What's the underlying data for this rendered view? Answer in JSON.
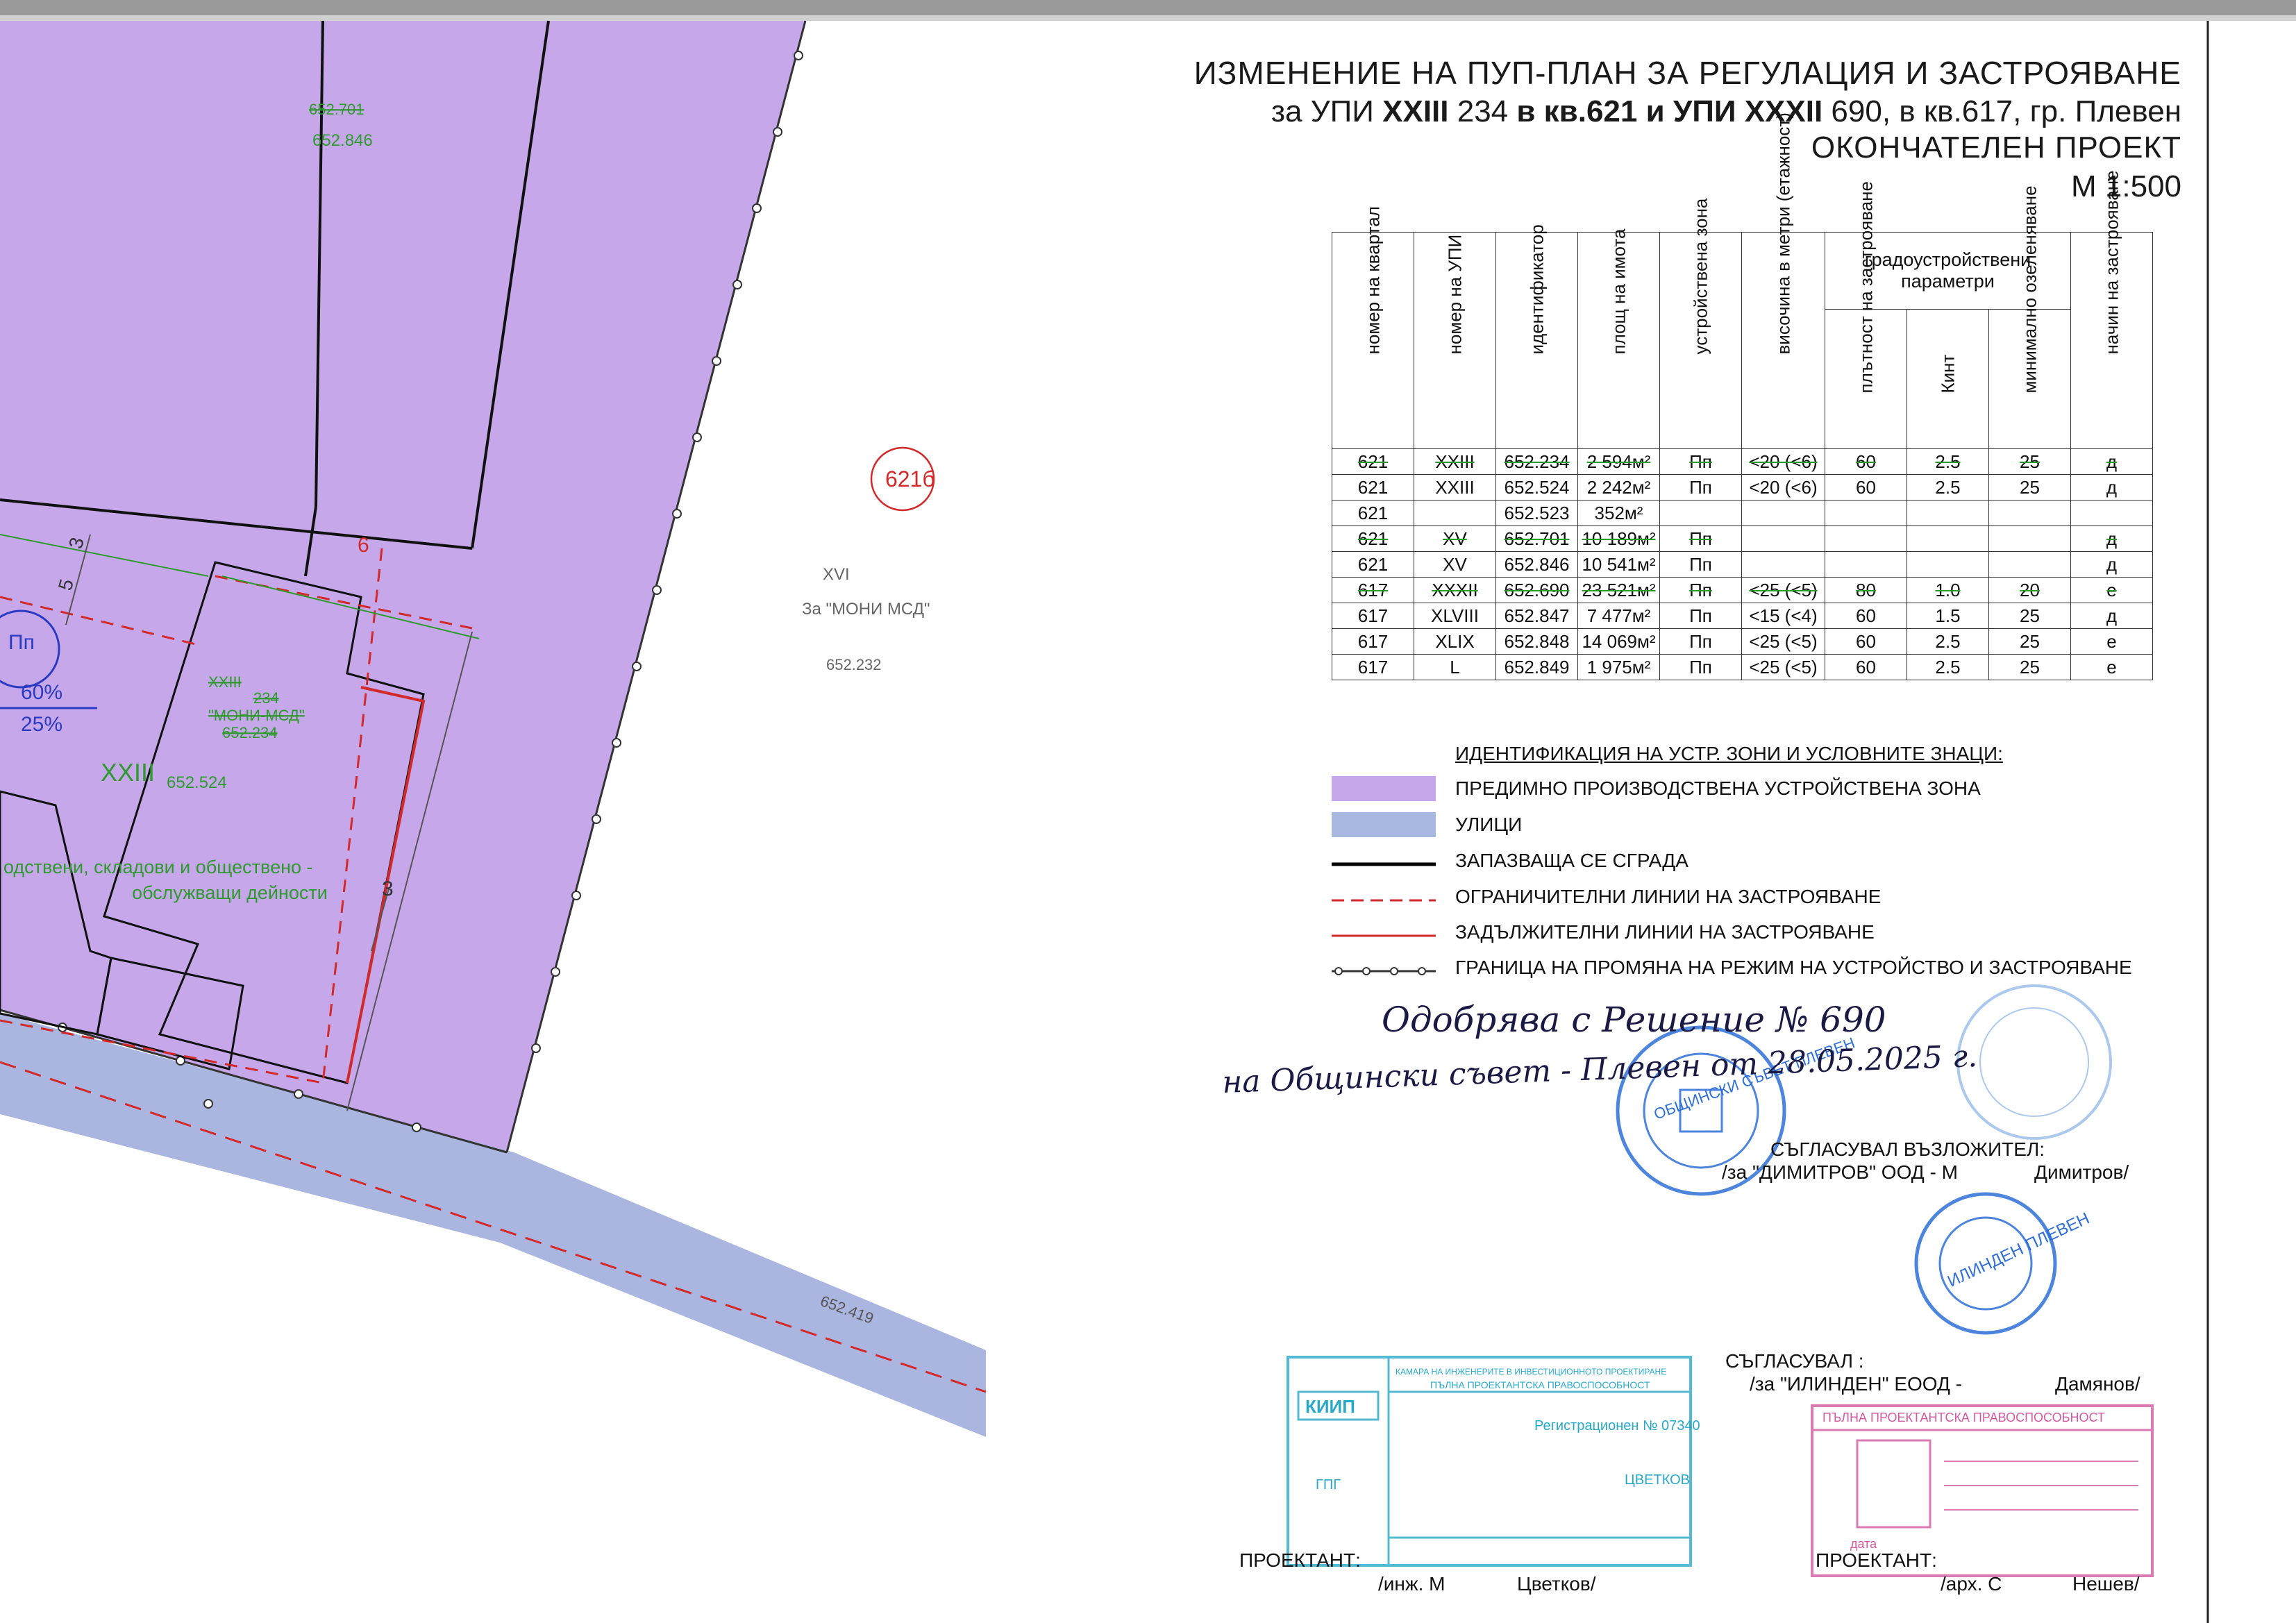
{
  "title": {
    "line1": "ИЗМЕНЕНИЕ НА ПУП-ПЛАН ЗА РЕГУЛАЦИЯ И ЗАСТРОЯВАНЕ",
    "line2_prefix": "за УПИ ",
    "line2_upi1": "XXIII",
    "line2_num1": " 234 ",
    "line2_kv1": "в кв.621 и УПИ XXXII",
    "line2_rest": " 690, в кв.617, гр. Плевен",
    "line3": "ОКОНЧАТЕЛЕН ПРОЕКТ",
    "line4": "М 1:500"
  },
  "table": {
    "headers": [
      "номер на квартал",
      "номер на УПИ",
      "идентификатор",
      "площ на имота",
      "устройствена зона",
      "височина в метри (етажност)"
    ],
    "group_header": "градоустройствени параметри",
    "sub_headers": [
      "плътност на застрояване",
      "Кинт",
      "минимално озеленяване"
    ],
    "last_header": "начин на застрояване",
    "rows": [
      {
        "cells": [
          "621",
          "XXIII",
          "652.234",
          "2 594м²",
          "Пп",
          "<20 (<6)",
          "60",
          "2.5",
          "25",
          "д"
        ],
        "struck": true
      },
      {
        "cells": [
          "621",
          "XXIII",
          "652.524",
          "2 242м²",
          "Пп",
          "<20 (<6)",
          "60",
          "2.5",
          "25",
          "д"
        ],
        "struck": false
      },
      {
        "cells": [
          "621",
          "",
          "652.523",
          "352м²",
          "",
          "",
          "",
          "",
          "",
          ""
        ],
        "struck": false
      },
      {
        "cells": [
          "621",
          "XV",
          "652.701",
          "10 189м²",
          "Пп",
          "",
          "",
          "",
          "",
          "д"
        ],
        "struck": true
      },
      {
        "cells": [
          "621",
          "XV",
          "652.846",
          "10 541м²",
          "Пп",
          "",
          "",
          "",
          "",
          "д"
        ],
        "struck": false
      },
      {
        "cells": [
          "617",
          "XXXII",
          "652.690",
          "23 521м²",
          "Пп",
          "<25 (<5)",
          "80",
          "1.0",
          "20",
          "е"
        ],
        "struck": true
      },
      {
        "cells": [
          "617",
          "XLVIII",
          "652.847",
          "7 477м²",
          "Пп",
          "<15 (<4)",
          "60",
          "1.5",
          "25",
          "д"
        ],
        "struck": false
      },
      {
        "cells": [
          "617",
          "XLIX",
          "652.848",
          "14 069м²",
          "Пп",
          "<25 (<5)",
          "60",
          "2.5",
          "25",
          "е"
        ],
        "struck": false
      },
      {
        "cells": [
          "617",
          "L",
          "652.849",
          "1 975м²",
          "Пп",
          "<25 (<5)",
          "60",
          "2.5",
          "25",
          "е"
        ],
        "struck": false
      }
    ]
  },
  "legend": {
    "title": "ИДЕНТИФИКАЦИЯ НА УСТР. ЗОНИ И УСЛОВНИТЕ ЗНАЦИ:",
    "items": [
      {
        "label": "ПРЕДИМНО ПРОИЗВОДСТВЕНА УСТРОЙСТВЕНА ЗОНА",
        "color": "#c6a8ea"
      },
      {
        "label": "УЛИЦИ",
        "color": "#a9b8e0"
      },
      {
        "label": "ЗАПАЗВАЩА СЕ СГРАДА",
        "color": "#000000"
      },
      {
        "label": "ОГРАНИЧИТЕЛНИ ЛИНИИ НА ЗАСТРОЯВАНЕ",
        "color": "#d22a2a"
      },
      {
        "label": "ЗАДЪЛЖИТЕЛНИ ЛИНИИ НА ЗАСТРОЯВАНЕ",
        "color": "#d22a2a"
      },
      {
        "label": "ГРАНИЦА НА ПРОМЯНА НА РЕЖИМ НА УСТРОЙСТВО И ЗАСТРОЯВАНЕ",
        "color": "#333333"
      }
    ]
  },
  "map": {
    "label_6216": "621б",
    "label_xvi": "XVI",
    "label_moni": "За \"МОНИ МСД\"",
    "label_652232": "652.232",
    "label_652701": "652.701",
    "label_652846": "652.846",
    "label_xxiii": "XXIII",
    "label_652524": "652.524",
    "label_xxiii_old": "XXIII",
    "label_234": "234",
    "label_moni_old": "\"МОНИ-МСД\"",
    "label_652234": "652.234",
    "label_pp": "Пп",
    "label_60": "60%",
    "label_25": "25%",
    "label_zone1": "одствени, складови и обществено -",
    "label_zone2": "обслужващи дейности",
    "dim_3a": "3",
    "dim_5": "5",
    "dim_6": "6",
    "dim_3b": "3",
    "label_652419": "652.419"
  },
  "handwriting": {
    "line1": "Одобрява с Решение № 690",
    "line2": "на Общински съвет - Плевен от 28.05.2025 г."
  },
  "signatures": {
    "s1_label": "СЪГЛАСУВАЛ ВЪЗЛОЖИТЕЛ:",
    "s1_name": "/за \"ДИМИТРОВ\" ООД - М",
    "s1_end": "Димитров/",
    "s2_label": "СЪГЛАСУВАЛ :",
    "s2_name": "/за \"ИЛИНДЕН\" ЕООД -",
    "s2_end": "Дамянов/",
    "s3_label": "ПРОЕКТАНТ:",
    "s3_name": "/инж. М",
    "s3_end": "Цветков/",
    "s4_label": "ПРОЕКТАНТ:",
    "s4_name": "/арх. С",
    "s4_end": "Нешев/"
  },
  "stamps": {
    "round1": "ОБЩИНСКИ СЪВЕТ ПЛЕВЕН",
    "round2": "ИЛИНДЕН ПЛЕВЕН",
    "kiip": "КИИП",
    "kiip_line1": "КАМАРА НА ИНЖЕНЕРИТЕ В ИНВЕСТИЦИОННОТО ПРОЕКТИРАНЕ",
    "kiip_line2": "ПЪЛНА ПРОЕКТАНТСКА ПРАВОСПОСОБНОСТ",
    "kiip_reg": "Регистрационен № 07340",
    "kiip_name": "ЦВЕТКОВ",
    "kiip_sect": "ГПГ",
    "arch_line": "ПЪЛНА ПРОЕКТАНТСКА ПРАВОСПОСОБНОСТ",
    "arch_date": "дата"
  },
  "colors": {
    "zone": "#c6a8ea",
    "street": "#a9b8e0",
    "green": "#2e9a2e",
    "red": "#d22a2a"
  }
}
